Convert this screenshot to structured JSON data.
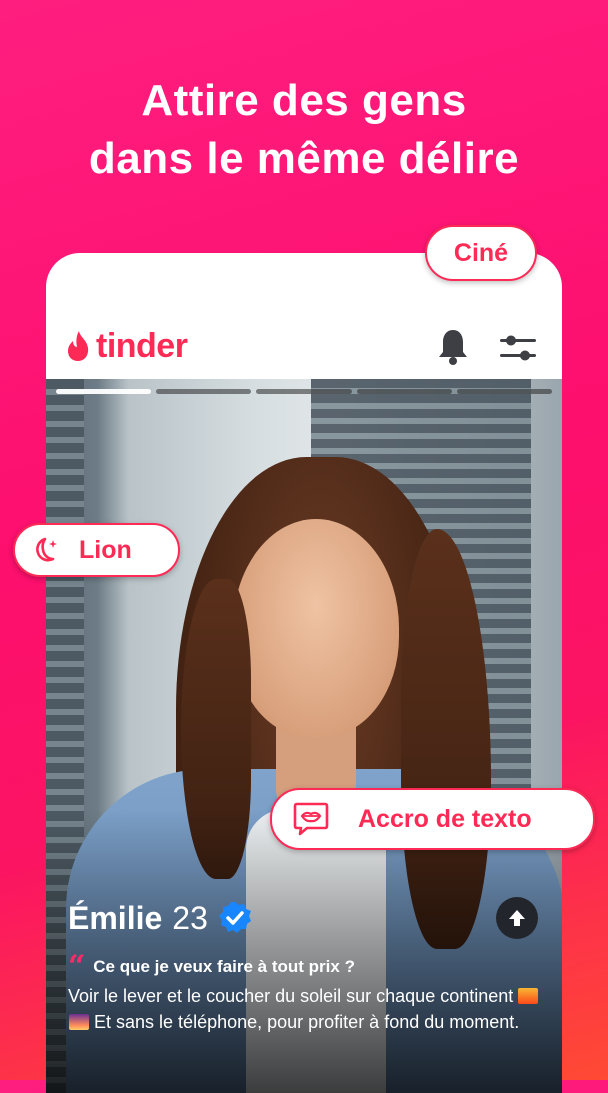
{
  "headline": {
    "line1": "Attire des gens",
    "line2": "dans le même délire"
  },
  "app": {
    "logo_text": "tinder",
    "brand_color": "#fd2a56"
  },
  "photo_progress": {
    "total": 5,
    "active_index": 0
  },
  "profile": {
    "name": "Émilie",
    "age": "23",
    "verified": true,
    "prompt_question": "Ce que je veux faire à tout prix ?",
    "answer_part1": "Voir le lever et le coucher du soleil sur chaque continent",
    "answer_part2": "Et sans le téléphone, pour profiter à fond du moment."
  },
  "chips": {
    "cine": "Ciné",
    "lion": "Lion",
    "texto": "Accro de texto"
  },
  "icons": {
    "logo": "flame-icon",
    "bell": "bell-icon",
    "filters": "sliders-icon",
    "verified": "verified-badge-icon",
    "up": "arrow-up-icon",
    "lion": "moon-stars-icon",
    "texto": "speech-bubble-lips-icon"
  }
}
